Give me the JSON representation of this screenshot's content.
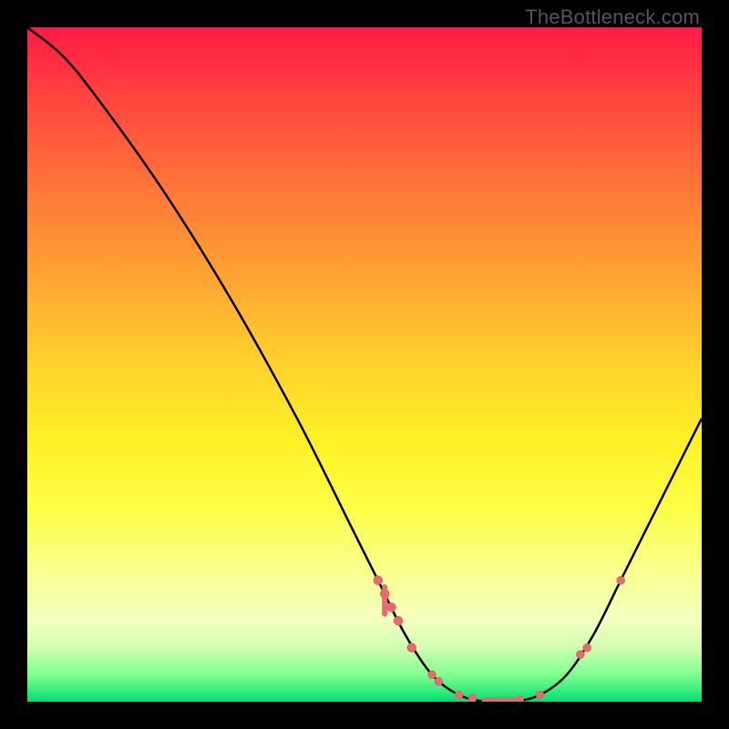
{
  "watermark": "TheBottleneck.com",
  "chart_data": {
    "type": "line",
    "title": "",
    "xlabel": "",
    "ylabel": "",
    "x_range": [
      0,
      100
    ],
    "y_range": [
      0,
      100
    ],
    "curve": [
      {
        "x": 0,
        "y": 100
      },
      {
        "x": 5,
        "y": 96
      },
      {
        "x": 10,
        "y": 90
      },
      {
        "x": 20,
        "y": 76
      },
      {
        "x": 30,
        "y": 60
      },
      {
        "x": 40,
        "y": 42
      },
      {
        "x": 48,
        "y": 26
      },
      {
        "x": 52,
        "y": 18
      },
      {
        "x": 56,
        "y": 10
      },
      {
        "x": 60,
        "y": 4
      },
      {
        "x": 64,
        "y": 1
      },
      {
        "x": 68,
        "y": 0
      },
      {
        "x": 72,
        "y": 0
      },
      {
        "x": 76,
        "y": 1
      },
      {
        "x": 80,
        "y": 4
      },
      {
        "x": 84,
        "y": 10
      },
      {
        "x": 88,
        "y": 18
      },
      {
        "x": 92,
        "y": 26
      },
      {
        "x": 96,
        "y": 34
      },
      {
        "x": 100,
        "y": 42
      }
    ],
    "markers_on_curve": [
      {
        "x": 52,
        "y": 18
      },
      {
        "x": 53,
        "y": 16
      },
      {
        "x": 54,
        "y": 14
      },
      {
        "x": 55,
        "y": 12
      },
      {
        "x": 57,
        "y": 8
      },
      {
        "x": 60,
        "y": 4
      },
      {
        "x": 61,
        "y": 3
      },
      {
        "x": 64,
        "y": 1
      },
      {
        "x": 66,
        "y": 0.5
      },
      {
        "x": 68,
        "y": 0
      },
      {
        "x": 69,
        "y": 0
      },
      {
        "x": 70,
        "y": 0
      },
      {
        "x": 71,
        "y": 0
      },
      {
        "x": 72,
        "y": 0
      },
      {
        "x": 73,
        "y": 0.3
      },
      {
        "x": 76,
        "y": 1
      },
      {
        "x": 82,
        "y": 7
      },
      {
        "x": 83,
        "y": 8
      },
      {
        "x": 88,
        "y": 18
      }
    ]
  }
}
